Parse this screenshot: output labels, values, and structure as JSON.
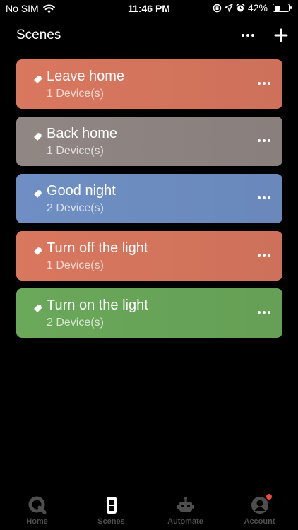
{
  "status_bar": {
    "carrier": "No SIM",
    "time": "11:46 PM",
    "battery_percent": "42%",
    "battery_level": 0.42
  },
  "header": {
    "title": "Scenes"
  },
  "scenes": [
    {
      "name": "Leave home",
      "devices": "1 Device(s)",
      "color": "#d9775f"
    },
    {
      "name": "Back home",
      "devices": "1 Device(s)",
      "color": "#908683"
    },
    {
      "name": "Good night",
      "devices": "2 Device(s)",
      "color": "#6f8fc4"
    },
    {
      "name": "Turn off the light",
      "devices": "1 Device(s)",
      "color": "#d9775f"
    },
    {
      "name": "Turn on the light",
      "devices": "2 Device(s)",
      "color": "#6aa85a"
    }
  ],
  "tabs": [
    {
      "label": "Home",
      "icon": "home-q-icon",
      "active": false
    },
    {
      "label": "Scenes",
      "icon": "scenes-icon",
      "active": true
    },
    {
      "label": "Automate",
      "icon": "robot-icon",
      "active": false
    },
    {
      "label": "Account",
      "icon": "account-icon",
      "active": false,
      "badge": true
    }
  ],
  "colors": {
    "background": "#000000",
    "tab_active": "#ffffff",
    "tab_inactive": "#4e4e4e",
    "badge": "#ec4a39"
  }
}
